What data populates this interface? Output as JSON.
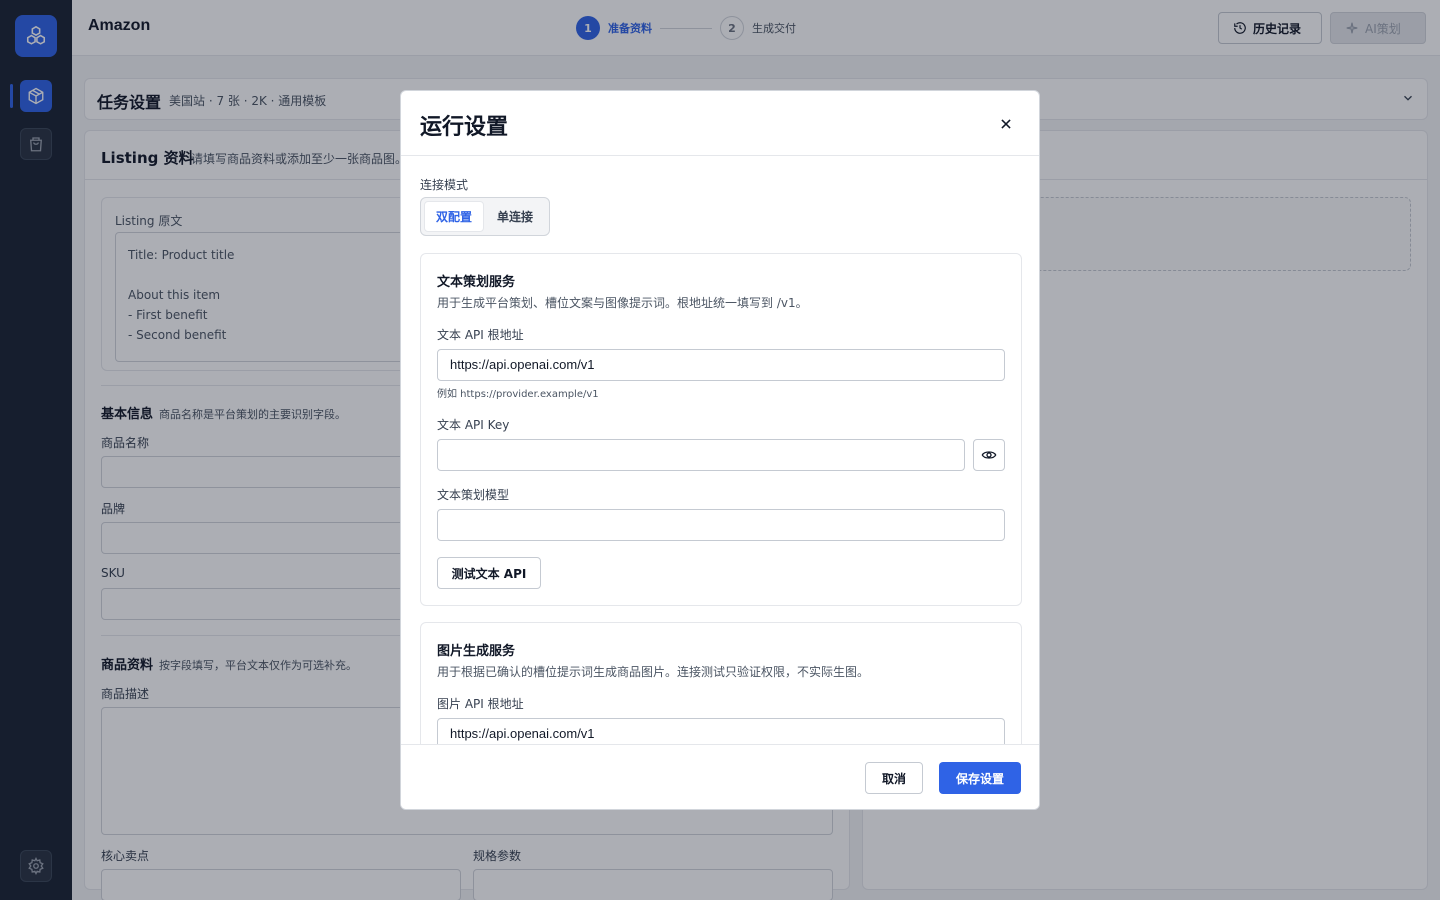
{
  "app": {
    "title": "Amazon"
  },
  "stepper": {
    "step1": {
      "num": "1",
      "label": "准备资料"
    },
    "step2": {
      "num": "2",
      "label": "生成交付"
    }
  },
  "top_actions": {
    "history": "历史记录",
    "ai": "AI策划"
  },
  "task": {
    "title": "任务设置",
    "summary": "美国站 · 7 张 · 2K · 通用模板"
  },
  "listing": {
    "title": "Listing 资料",
    "subtitle": "请填写商品资料或添加至少一张商品图。",
    "original_label": "Listing 原文",
    "original_lines": [
      "Title: Product title",
      "",
      "About this item",
      "- First benefit",
      "- Second benefit"
    ],
    "basic_title": "基本信息",
    "basic_sub": "商品名称是平台策划的主要识别字段。",
    "name_label": "商品名称",
    "brand_label": "品牌",
    "sku_label": "SKU",
    "detail_title": "商品资料",
    "detail_sub": "按字段填写，平台文本仅作为可选补充。",
    "desc_label": "商品描述",
    "selling_label": "核心卖点",
    "spec_label": "规格参数"
  },
  "modal": {
    "title": "运行设置",
    "mode_label": "连接模式",
    "modes": [
      "双配置",
      "单连接"
    ],
    "selected_mode": "双配置",
    "text_service": {
      "title": "文本策划服务",
      "desc": "用于生成平台策划、槽位文案与图像提示词。根地址统一填写到 /v1。",
      "base_label": "文本 API 根地址",
      "base_value": "https://api.openai.com/v1",
      "hint": "例如 https://provider.example/v1",
      "key_label": "文本 API Key",
      "key_value": "",
      "model_label": "文本策划模型",
      "model_value": "",
      "test_button": "测试文本 API"
    },
    "image_service": {
      "title": "图片生成服务",
      "desc": "用于根据已确认的槽位提示词生成商品图片。连接测试只验证权限，不实际生图。",
      "base_label": "图片 API 根地址",
      "base_value": "https://api.openai.com/v1"
    },
    "cancel": "取消",
    "save": "保存设置"
  },
  "colors": {
    "accent": "#2f63e6",
    "sidebar": "#1a2332"
  }
}
